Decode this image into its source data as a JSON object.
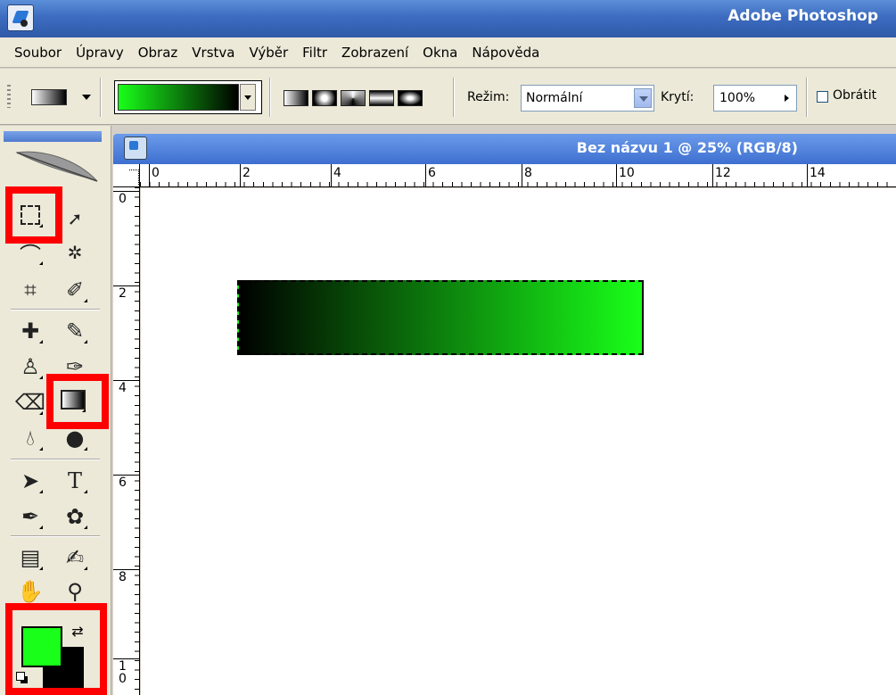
{
  "window": {
    "title": "Adobe Photoshop"
  },
  "menu": [
    "Soubor",
    "Úpravy",
    "Obraz",
    "Vrstva",
    "Výběr",
    "Filtr",
    "Zobrazení",
    "Okna",
    "Nápověda"
  ],
  "options": {
    "mode_label": "Režim:",
    "mode_value": "Normální",
    "opacity_label": "Krytí:",
    "opacity_value": "100%",
    "reverse_label": "Obrátit",
    "gradient_colors": [
      "#19ff19",
      "#000000"
    ]
  },
  "toolbox": {
    "foreground_color": "#19ff19",
    "background_color": "#000000",
    "highlight_color": "#ff0000",
    "tools": [
      "marquee-tool",
      "move-tool",
      "lasso-tool",
      "magic-wand-tool",
      "crop-tool",
      "slice-tool",
      "healing-brush-tool",
      "brush-tool",
      "clone-stamp-tool",
      "history-brush-tool",
      "eraser-tool",
      "gradient-tool",
      "blur-tool",
      "dodge-tool",
      "path-selection-tool",
      "type-tool",
      "pen-tool",
      "custom-shape-tool",
      "notes-tool",
      "eyedropper-tool",
      "hand-tool",
      "zoom-tool"
    ]
  },
  "document": {
    "title": "Bez názvu 1 @ 25% (RGB/8)",
    "ruler_h": [
      "0",
      "2",
      "4",
      "6",
      "8",
      "10",
      "12",
      "14"
    ],
    "ruler_v": [
      "0",
      "2",
      "4",
      "6",
      "8",
      "1\n0"
    ],
    "gradient_colors": [
      "#000000",
      "#19ff19"
    ]
  }
}
